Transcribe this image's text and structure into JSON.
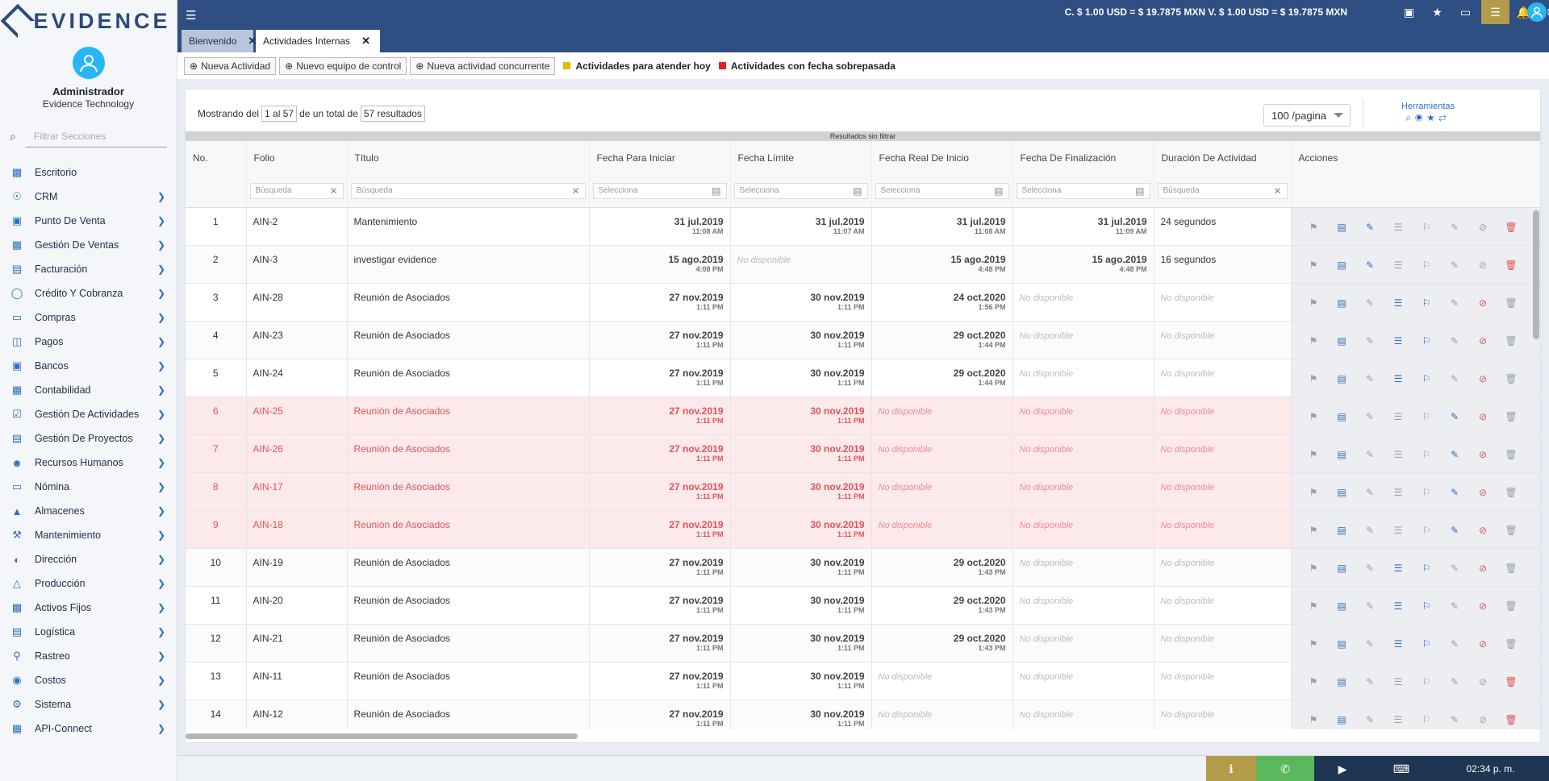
{
  "brand": {
    "name": "EVIDENCE"
  },
  "user": {
    "name": "Administrador",
    "company": "Evidence Technology"
  },
  "sidebar": {
    "filter_placeholder": "Filtrar Secciones",
    "items": [
      {
        "label": "Escritorio",
        "icon": "desktop-icon",
        "has_sub": false
      },
      {
        "label": "CRM",
        "icon": "crm-icon",
        "has_sub": true
      },
      {
        "label": "Punto De Venta",
        "icon": "pos-icon",
        "has_sub": true
      },
      {
        "label": "Gestión De Ventas",
        "icon": "sales-icon",
        "has_sub": true
      },
      {
        "label": "Facturación",
        "icon": "invoice-icon",
        "has_sub": true
      },
      {
        "label": "Crédito Y Cobranza",
        "icon": "credit-icon",
        "has_sub": true
      },
      {
        "label": "Compras",
        "icon": "purchases-icon",
        "has_sub": true
      },
      {
        "label": "Pagos",
        "icon": "payments-icon",
        "has_sub": true
      },
      {
        "label": "Bancos",
        "icon": "bank-icon",
        "has_sub": true
      },
      {
        "label": "Contabilidad",
        "icon": "accounting-icon",
        "has_sub": true
      },
      {
        "label": "Gestión De Actividades",
        "icon": "activities-icon",
        "has_sub": true
      },
      {
        "label": "Gestión De Proyectos",
        "icon": "projects-icon",
        "has_sub": true
      },
      {
        "label": "Recursos Humanos",
        "icon": "hr-icon",
        "has_sub": true
      },
      {
        "label": "Nómina",
        "icon": "payroll-icon",
        "has_sub": true
      },
      {
        "label": "Almacenes",
        "icon": "warehouse-icon",
        "has_sub": true
      },
      {
        "label": "Mantenimiento",
        "icon": "wrench-icon",
        "has_sub": true
      },
      {
        "label": "Dirección",
        "icon": "direction-icon",
        "has_sub": true
      },
      {
        "label": "Producción",
        "icon": "production-icon",
        "has_sub": true
      },
      {
        "label": "Activos Fijos",
        "icon": "assets-icon",
        "has_sub": true
      },
      {
        "label": "Logística",
        "icon": "truck-icon",
        "has_sub": true
      },
      {
        "label": "Rastreo",
        "icon": "map-pin-icon",
        "has_sub": true
      },
      {
        "label": "Costos",
        "icon": "costs-icon",
        "has_sub": true
      },
      {
        "label": "Sistema",
        "icon": "system-icon",
        "has_sub": true
      },
      {
        "label": "API-Connect",
        "icon": "api-icon",
        "has_sub": true
      }
    ]
  },
  "topbar": {
    "rates": "C. $ 1.00 USD = $ 19.7875 MXN    V. $ 1.00 USD = $ 19.7875 MXN"
  },
  "tabs": [
    {
      "label": "Bienvenido"
    },
    {
      "label": "Actividades Internas"
    }
  ],
  "actions": {
    "new_activity": "Nueva Actividad",
    "new_control_team": "Nuevo equipo de control",
    "new_concurrent": "Nueva actividad concurrente",
    "legend_today": "Actividades para atender hoy",
    "legend_overdue": "Actividades con fecha sobrepasada"
  },
  "colors": {
    "today": "#e6b800",
    "overdue": "#e02424",
    "accent": "#2f4e82"
  },
  "panel": {
    "showing_prefix": "Mostrando del",
    "range": "1 al 57",
    "of_total": "de un total de",
    "total": "57 resultados",
    "per_page": "100 /pagina",
    "tools_label": "Herramientas",
    "filter_status": "Resultados sin filtrar"
  },
  "table": {
    "headers": [
      "No.",
      "Folio",
      "Título",
      "Fecha Para Iniciar",
      "Fecha Límite",
      "Fecha Real De Inicio",
      "Fecha De Finalización",
      "Duración De Actividad",
      "Acciones"
    ],
    "filters": [
      "Búsqueda",
      "Búsqueda",
      "Selecciona",
      "Selecciona",
      "Selecciona",
      "Selecciona",
      "Búsqueda"
    ],
    "na": "No disponible",
    "rows": [
      {
        "no": "1",
        "folio": "AIN-2",
        "titulo": "Mantenimiento",
        "late": false,
        "inicio": {
          "d": "31 jul.2019",
          "t": "11:08 AM"
        },
        "limite": {
          "d": "31 jul.2019",
          "t": "11:07 AM"
        },
        "real": {
          "d": "31 jul.2019",
          "t": "11:08 AM"
        },
        "fin": {
          "d": "31 jul.2019",
          "t": "11:09 AM"
        },
        "duracion": "24 segundos",
        "acts": [
          "g",
          "b",
          "b",
          "g",
          "g",
          "g",
          "g",
          "r"
        ]
      },
      {
        "no": "2",
        "folio": "AIN-3",
        "titulo": "investigar evidence",
        "late": false,
        "inicio": {
          "d": "15 ago.2019",
          "t": "4:08 PM"
        },
        "limite": null,
        "real": {
          "d": "15 ago.2019",
          "t": "4:48 PM"
        },
        "fin": {
          "d": "15 ago.2019",
          "t": "4:48 PM"
        },
        "duracion": "16 segundos",
        "acts": [
          "g",
          "b",
          "b",
          "g",
          "g",
          "g",
          "g",
          "r"
        ]
      },
      {
        "no": "3",
        "folio": "AIN-28",
        "titulo": "Reunión de Asociados",
        "late": false,
        "inicio": {
          "d": "27 nov.2019",
          "t": "1:11 PM"
        },
        "limite": {
          "d": "30 nov.2019",
          "t": "1:11 PM"
        },
        "real": {
          "d": "24 oct.2020",
          "t": "1:56 PM"
        },
        "fin": null,
        "duracion": null,
        "acts": [
          "g",
          "b",
          "g",
          "b",
          "b",
          "g",
          "r",
          "g"
        ]
      },
      {
        "no": "4",
        "folio": "AIN-23",
        "titulo": "Reunión de Asociados",
        "late": false,
        "inicio": {
          "d": "27 nov.2019",
          "t": "1:11 PM"
        },
        "limite": {
          "d": "30 nov.2019",
          "t": "1:11 PM"
        },
        "real": {
          "d": "29 oct.2020",
          "t": "1:44 PM"
        },
        "fin": null,
        "duracion": null,
        "acts": [
          "g",
          "b",
          "g",
          "b",
          "b",
          "g",
          "r",
          "g"
        ]
      },
      {
        "no": "5",
        "folio": "AIN-24",
        "titulo": "Reunión de Asociados",
        "late": false,
        "inicio": {
          "d": "27 nov.2019",
          "t": "1:11 PM"
        },
        "limite": {
          "d": "30 nov.2019",
          "t": "1:11 PM"
        },
        "real": {
          "d": "29 oct.2020",
          "t": "1:44 PM"
        },
        "fin": null,
        "duracion": null,
        "acts": [
          "g",
          "b",
          "g",
          "b",
          "b",
          "g",
          "r",
          "g"
        ]
      },
      {
        "no": "6",
        "folio": "AIN-25",
        "titulo": "Reunión de Asociados",
        "late": true,
        "inicio": {
          "d": "27 nov.2019",
          "t": "1:11 PM"
        },
        "limite": {
          "d": "30 nov.2019",
          "t": "1:11 PM"
        },
        "real": null,
        "fin": null,
        "duracion": null,
        "acts": [
          "g",
          "b",
          "g",
          "g",
          "g",
          "b",
          "r",
          "g"
        ]
      },
      {
        "no": "7",
        "folio": "AIN-26",
        "titulo": "Reunión de Asociados",
        "late": true,
        "inicio": {
          "d": "27 nov.2019",
          "t": "1:11 PM"
        },
        "limite": {
          "d": "30 nov.2019",
          "t": "1:11 PM"
        },
        "real": null,
        "fin": null,
        "duracion": null,
        "acts": [
          "g",
          "b",
          "g",
          "g",
          "g",
          "b",
          "r",
          "g"
        ]
      },
      {
        "no": "8",
        "folio": "AIN-17",
        "titulo": "Reunión de Asociados",
        "late": true,
        "inicio": {
          "d": "27 nov.2019",
          "t": "1:11 PM"
        },
        "limite": {
          "d": "30 nov.2019",
          "t": "1:11 PM"
        },
        "real": null,
        "fin": null,
        "duracion": null,
        "acts": [
          "g",
          "b",
          "g",
          "g",
          "g",
          "b",
          "r",
          "g"
        ]
      },
      {
        "no": "9",
        "folio": "AIN-18",
        "titulo": "Reunión de Asociados",
        "late": true,
        "inicio": {
          "d": "27 nov.2019",
          "t": "1:11 PM"
        },
        "limite": {
          "d": "30 nov.2019",
          "t": "1:11 PM"
        },
        "real": null,
        "fin": null,
        "duracion": null,
        "acts": [
          "g",
          "b",
          "g",
          "g",
          "g",
          "b",
          "r",
          "g"
        ]
      },
      {
        "no": "10",
        "folio": "AIN-19",
        "titulo": "Reunión de Asociados",
        "late": false,
        "inicio": {
          "d": "27 nov.2019",
          "t": "1:11 PM"
        },
        "limite": {
          "d": "30 nov.2019",
          "t": "1:11 PM"
        },
        "real": {
          "d": "29 oct.2020",
          "t": "1:43 PM"
        },
        "fin": null,
        "duracion": null,
        "acts": [
          "g",
          "b",
          "g",
          "b",
          "b",
          "g",
          "r",
          "g"
        ]
      },
      {
        "no": "11",
        "folio": "AIN-20",
        "titulo": "Reunión de Asociados",
        "late": false,
        "inicio": {
          "d": "27 nov.2019",
          "t": "1:11 PM"
        },
        "limite": {
          "d": "30 nov.2019",
          "t": "1:11 PM"
        },
        "real": {
          "d": "29 oct.2020",
          "t": "1:43 PM"
        },
        "fin": null,
        "duracion": null,
        "acts": [
          "g",
          "b",
          "g",
          "b",
          "b",
          "g",
          "r",
          "g"
        ]
      },
      {
        "no": "12",
        "folio": "AIN-21",
        "titulo": "Reunión de Asociados",
        "late": false,
        "inicio": {
          "d": "27 nov.2019",
          "t": "1:11 PM"
        },
        "limite": {
          "d": "30 nov.2019",
          "t": "1:11 PM"
        },
        "real": {
          "d": "29 oct.2020",
          "t": "1:43 PM"
        },
        "fin": null,
        "duracion": null,
        "acts": [
          "g",
          "b",
          "g",
          "b",
          "b",
          "g",
          "r",
          "g"
        ]
      },
      {
        "no": "13",
        "folio": "AIN-11",
        "titulo": "Reunión de Asociados",
        "late": false,
        "inicio": {
          "d": "27 nov.2019",
          "t": "1:11 PM"
        },
        "limite": {
          "d": "30 nov.2019",
          "t": "1:11 PM"
        },
        "real": null,
        "fin": null,
        "duracion": null,
        "acts": [
          "g",
          "b",
          "g",
          "g",
          "g",
          "g",
          "g",
          "r"
        ]
      },
      {
        "no": "14",
        "folio": "AIN-12",
        "titulo": "Reunión de Asociados",
        "late": false,
        "inicio": {
          "d": "27 nov.2019",
          "t": "1:11 PM"
        },
        "limite": {
          "d": "30 nov.2019",
          "t": "1:11 PM"
        },
        "real": null,
        "fin": null,
        "duracion": null,
        "acts": [
          "g",
          "b",
          "g",
          "g",
          "g",
          "g",
          "g",
          "r"
        ]
      }
    ]
  },
  "footer": {
    "clock": "02:34 p. m."
  }
}
